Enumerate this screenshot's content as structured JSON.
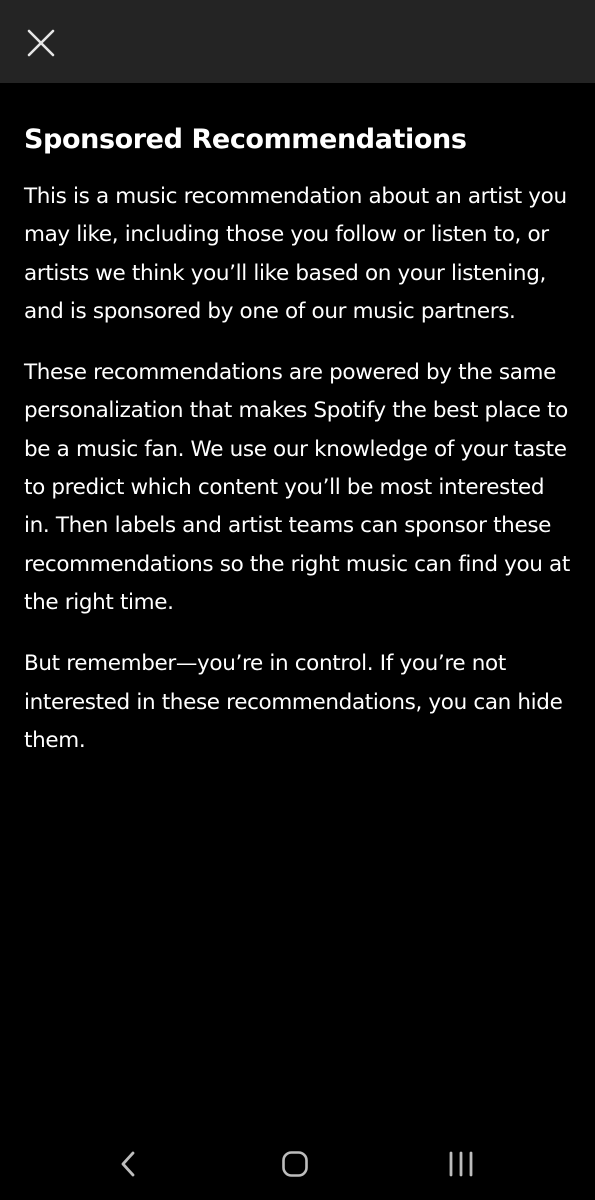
{
  "header": {
    "close_icon": "close-icon"
  },
  "content": {
    "title": "Sponsored Recommendations",
    "paragraphs": [
      "This is a music recommendation about an artist you may like, including those you follow or listen to, or artists we think you’ll like based on your listening, and is sponsored by one of our music partners.",
      "These recommendations are powered by the same personalization that makes Spotify the best place to be a music fan. We use our knowledge of your taste to predict which content you’ll be most interested in. Then labels and artist teams can sponsor these recommendations so the right music can find you at the right time.",
      "But remember—you’re in control. If you’re not interested in these recommendations, you can hide them."
    ]
  },
  "nav_bar": {
    "icons": [
      "back-icon",
      "home-icon",
      "recents-icon"
    ]
  },
  "colors": {
    "background": "#000000",
    "header_background": "#242424",
    "text": "#ffffff",
    "nav_icon": "#bdbdbd"
  }
}
